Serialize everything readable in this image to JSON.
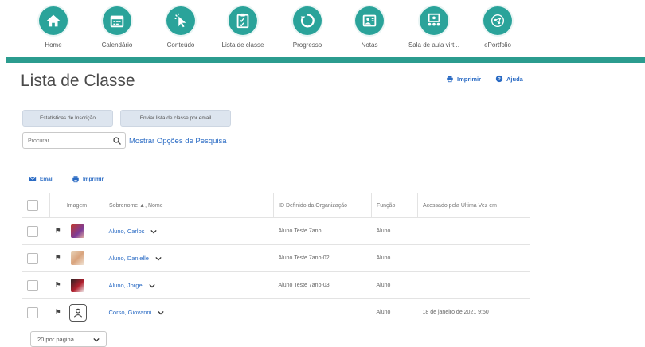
{
  "nav": {
    "items": [
      {
        "label": "Home",
        "icon": "home-icon"
      },
      {
        "label": "Calendário",
        "icon": "calendar-icon"
      },
      {
        "label": "Conteúdo",
        "icon": "cursor-icon"
      },
      {
        "label": "Lista de classe",
        "icon": "clipboard-icon"
      },
      {
        "label": "Progresso",
        "icon": "progress-icon"
      },
      {
        "label": "Notas",
        "icon": "grades-icon"
      },
      {
        "label": "Sala de aula virt...",
        "icon": "virtual-classroom-icon"
      },
      {
        "label": "ePortfolio",
        "icon": "eportfolio-icon"
      }
    ],
    "accent": "#2aa39a"
  },
  "header": {
    "title": "Lista de Classe",
    "print_label": "Imprimir",
    "help_label": "Ajuda"
  },
  "actions": {
    "enrollment_stats": "Estatísticas de Inscrição",
    "email_list": "Enviar lista de classe por email"
  },
  "search": {
    "placeholder": "Procurar",
    "options_label": "Mostrar Opções de Pesquisa"
  },
  "toolbar": {
    "email_label": "Email",
    "print_label": "Imprimir"
  },
  "table": {
    "headers": {
      "image": "Imagem",
      "name": "Sobrenome ▲, Nome",
      "org_id": "ID Definido da Organização",
      "role": "Função",
      "last_access": "Acessado pela Última Vez em"
    },
    "rows": [
      {
        "name": "Aluno, Carlos",
        "org_id": "Aluno Teste 7ano",
        "role": "Aluno",
        "last_access": "",
        "avatar": "photo"
      },
      {
        "name": "Aluno, Danielle",
        "org_id": "Aluno Teste 7ano-02",
        "role": "Aluno",
        "last_access": "",
        "avatar": "photo"
      },
      {
        "name": "Aluno, Jorge",
        "org_id": "Aluno Teste 7ano-03",
        "role": "Aluno",
        "last_access": "",
        "avatar": "photo"
      },
      {
        "name": "Corso, Giovanni",
        "org_id": "",
        "role": "Aluno",
        "last_access": "18 de janeiro de 2021 9:50",
        "avatar": "placeholder-user-icon"
      }
    ]
  },
  "pagination": {
    "per_page": "20 por página"
  }
}
